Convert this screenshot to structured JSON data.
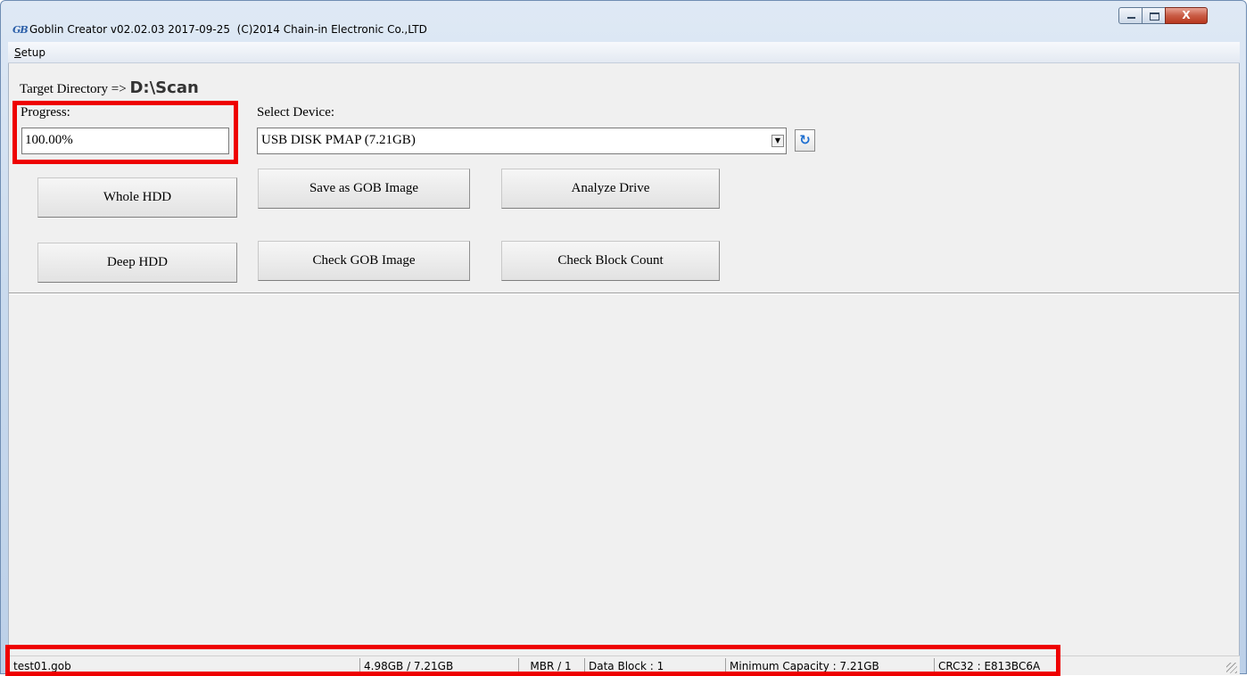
{
  "window": {
    "title": "Goblin Creator v02.02.03 2017-09-25  (C)2014 Chain-in Electronic Co.,LTD",
    "icon_text": "GB",
    "close_glyph": "X"
  },
  "menu": {
    "setup": "Setup"
  },
  "target": {
    "label": "Target Directory => ",
    "path": "D:\\Scan"
  },
  "progress": {
    "label": "Progress:",
    "value": "100.00%"
  },
  "device": {
    "label": "Select Device:",
    "selected": "USB DISK PMAP (7.21GB)",
    "dropdown_glyph": "▼",
    "refresh_glyph": "↻"
  },
  "buttons": {
    "whole_hdd": "Whole HDD",
    "save_gob": "Save as GOB Image",
    "analyze": "Analyze Drive",
    "deep_hdd": "Deep HDD",
    "check_gob": "Check GOB Image",
    "check_block": "Check Block Count"
  },
  "status": {
    "file": "test01.gob",
    "size": "4.98GB / 7.21GB",
    "mbr": "MBR / 1",
    "data_block": "Data Block : 1",
    "min_capacity": "Minimum Capacity : 7.21GB",
    "crc": "CRC32 : E813BC6A"
  },
  "colors": {
    "highlight": "#ee0000",
    "refresh_icon": "#1f6fd0"
  }
}
